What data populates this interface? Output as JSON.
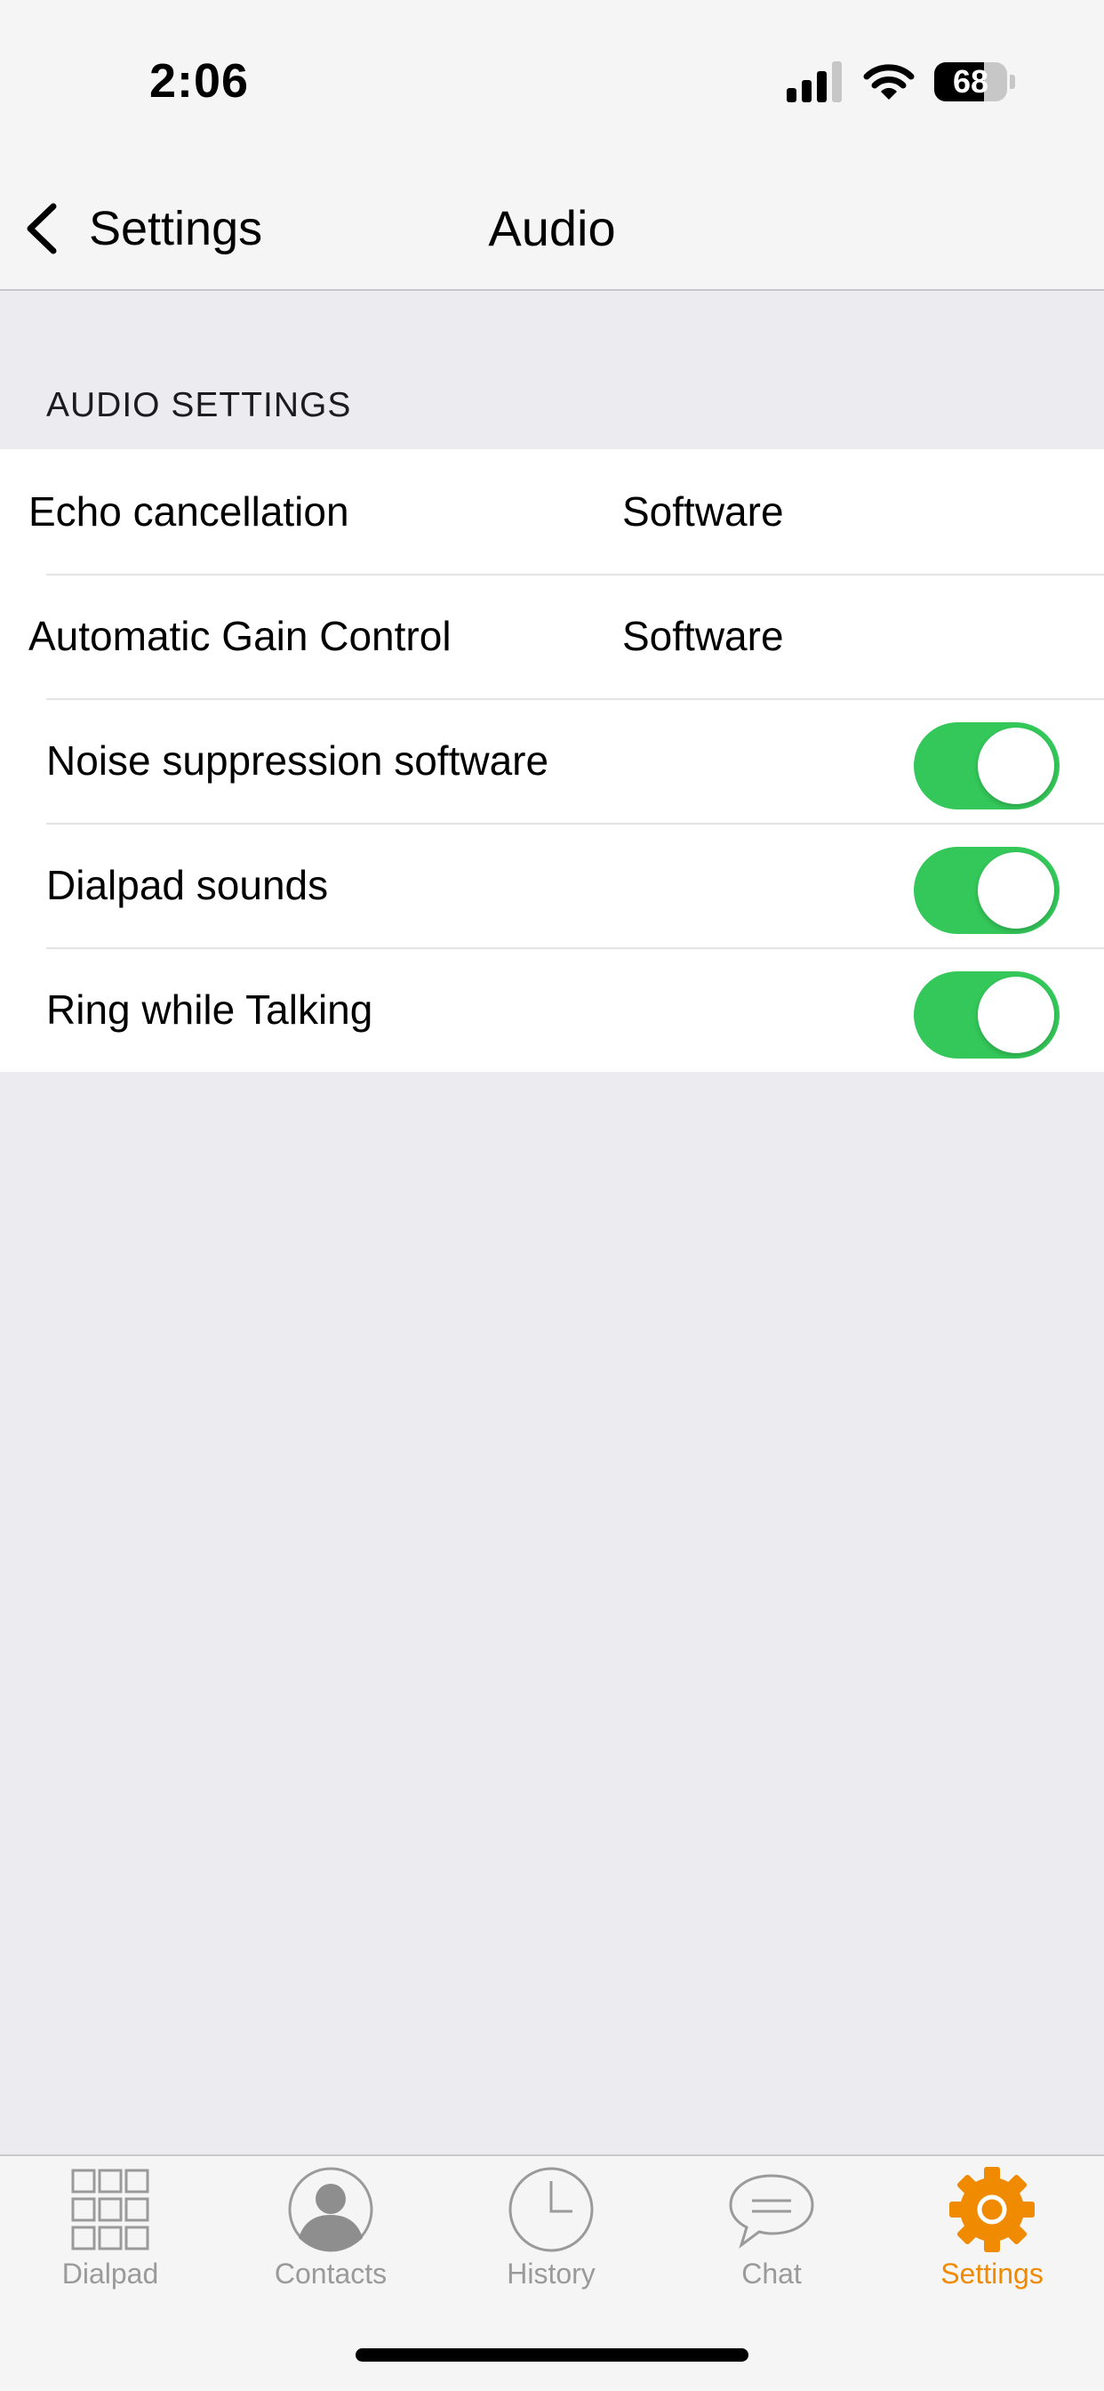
{
  "status_bar": {
    "time": "2:06",
    "battery_level": "68",
    "battery_fraction": 0.68
  },
  "nav": {
    "back_label": "Settings",
    "title": "Audio"
  },
  "section": {
    "header": "AUDIO SETTINGS",
    "rows": [
      {
        "label": "Echo cancellation",
        "value": "Software"
      },
      {
        "label": "Automatic Gain Control",
        "value": "Software"
      },
      {
        "label": "Noise suppression software",
        "toggle_on": true
      },
      {
        "label": "Dialpad sounds",
        "toggle_on": true
      },
      {
        "label": "Ring while Talking",
        "toggle_on": true
      }
    ]
  },
  "tabbar": {
    "items": [
      {
        "label": "Dialpad",
        "icon": "dialpad-grid-icon",
        "active": false
      },
      {
        "label": "Contacts",
        "icon": "contact-person-icon",
        "active": false
      },
      {
        "label": "History",
        "icon": "clock-icon",
        "active": false
      },
      {
        "label": "Chat",
        "icon": "chat-bubble-icon",
        "active": false
      },
      {
        "label": "Settings",
        "icon": "gear-icon",
        "active": true
      }
    ]
  },
  "colors": {
    "accent": "#F08A00",
    "toggle_on": "#34C759",
    "inactive_tab": "#9A9A9A",
    "header_bg": "#F5F5F5",
    "page_bg": "#EBEBF0"
  }
}
